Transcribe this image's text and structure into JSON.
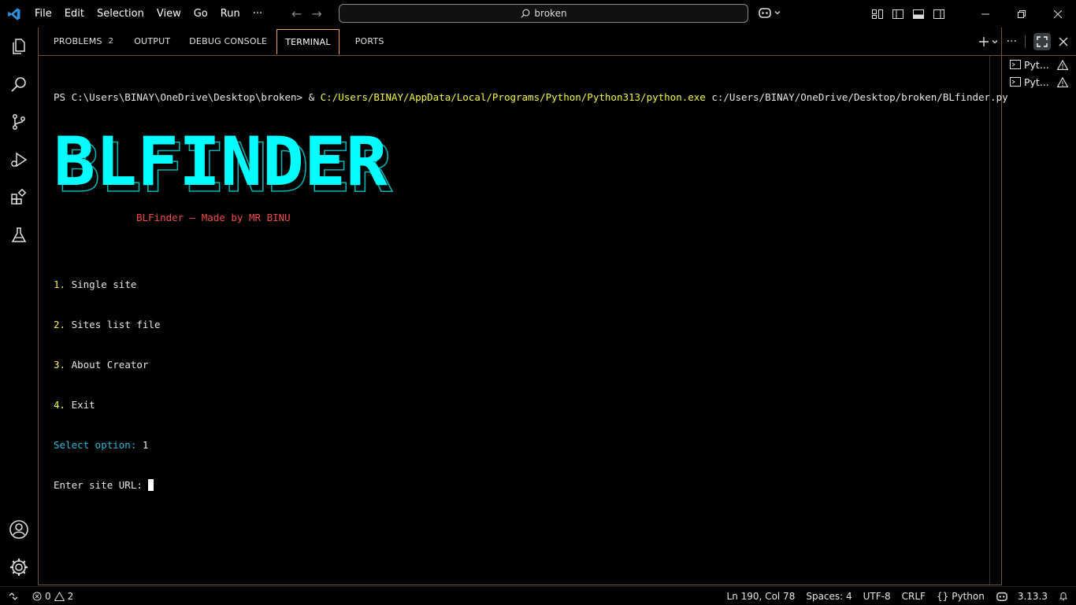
{
  "menu": [
    "File",
    "Edit",
    "Selection",
    "View",
    "Go",
    "Run",
    "···"
  ],
  "search": {
    "text": "broken"
  },
  "tabs": [
    {
      "label": "PROBLEMS",
      "badge": "2"
    },
    {
      "label": "OUTPUT"
    },
    {
      "label": "DEBUG CONSOLE"
    },
    {
      "label": "TERMINAL"
    },
    {
      "label": "PORTS"
    }
  ],
  "terminal": {
    "prompt": "PS C:\\Users\\BINAY\\OneDrive\\Desktop\\broken> & ",
    "exe_path": "C:/Users/BINAY/AppData/Local/Programs/Python/Python313/python.exe",
    "script_arg": " c:/Users/BINAY/OneDrive/Desktop/broken/BLfinder.py",
    "banner": "BLFINDER",
    "credit": "BLFinder — Made by MR BINU",
    "options": [
      {
        "num": "1.",
        "label": " Single site"
      },
      {
        "num": "2.",
        "label": " Sites list file"
      },
      {
        "num": "3.",
        "label": " About Creator"
      },
      {
        "num": "4.",
        "label": " Exit"
      }
    ],
    "select_label": "Select option:",
    "select_value": " 1",
    "url_prompt": "Enter site URL: "
  },
  "terminal_list": [
    {
      "label": "Pyt..."
    },
    {
      "label": "Pyt..."
    }
  ],
  "status": {
    "errors": "0",
    "warnings": "2",
    "position": "Ln 190, Col 78",
    "spaces": "Spaces: 4",
    "encoding": "UTF-8",
    "eol": "CRLF",
    "language": "Python",
    "version": "3.13.3"
  },
  "colors": {
    "accent": "#e8a060",
    "banner": "#00ffff",
    "prompt_yellow": "#f5f543",
    "credit_red": "#f14c4c",
    "option_cyan": "#29b8db"
  }
}
